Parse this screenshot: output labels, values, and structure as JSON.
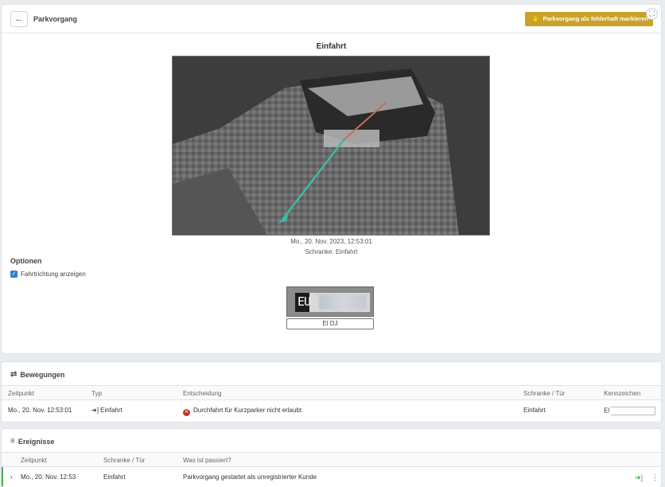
{
  "header": {
    "title": "Parkvorgang",
    "mark_button": "Parkvorgang als fehlerhaft markieren",
    "back_icon": "←",
    "expand_icon": "⛶"
  },
  "entry": {
    "title": "Einfahrt",
    "date": "Mo., 20. Nov. 2023, 12:53:01",
    "barrier": "Schranke: Einfahrt"
  },
  "options": {
    "title": "Optionen",
    "show_direction_label": "Fahrtrichtung anzeigen",
    "show_direction_checked": true
  },
  "plate": {
    "image_text": "EU",
    "input_value": "El                    DJ"
  },
  "movements": {
    "title": "Bewegungen",
    "columns": [
      "Zeitpunkt",
      "Typ",
      "Entscheidung",
      "Schranke / Tür",
      "Kennzeichen"
    ],
    "rows": [
      {
        "time": "Mo., 20. Nov.   12:53:01",
        "type": "Einfahrt",
        "decision": "Durchfahrt für Kurzparker nicht erlaubt",
        "barrier": "Einfahrt",
        "plate": "El"
      }
    ]
  },
  "events": {
    "title": "Ereignisse",
    "columns": [
      "Zeitpunkt",
      "Schranke / Tür",
      "Was ist passiert?"
    ],
    "rows": [
      {
        "time": "Mo., 20. Nov.   12:53",
        "barrier": "Einfahrt",
        "what": "Parkvorgang gestartet als unregistrierter Kunde"
      }
    ]
  },
  "colors": {
    "accent": "#c9a227",
    "checkbox": "#2f7ed8",
    "deny": "#c0392b",
    "enter": "#4caf50"
  }
}
